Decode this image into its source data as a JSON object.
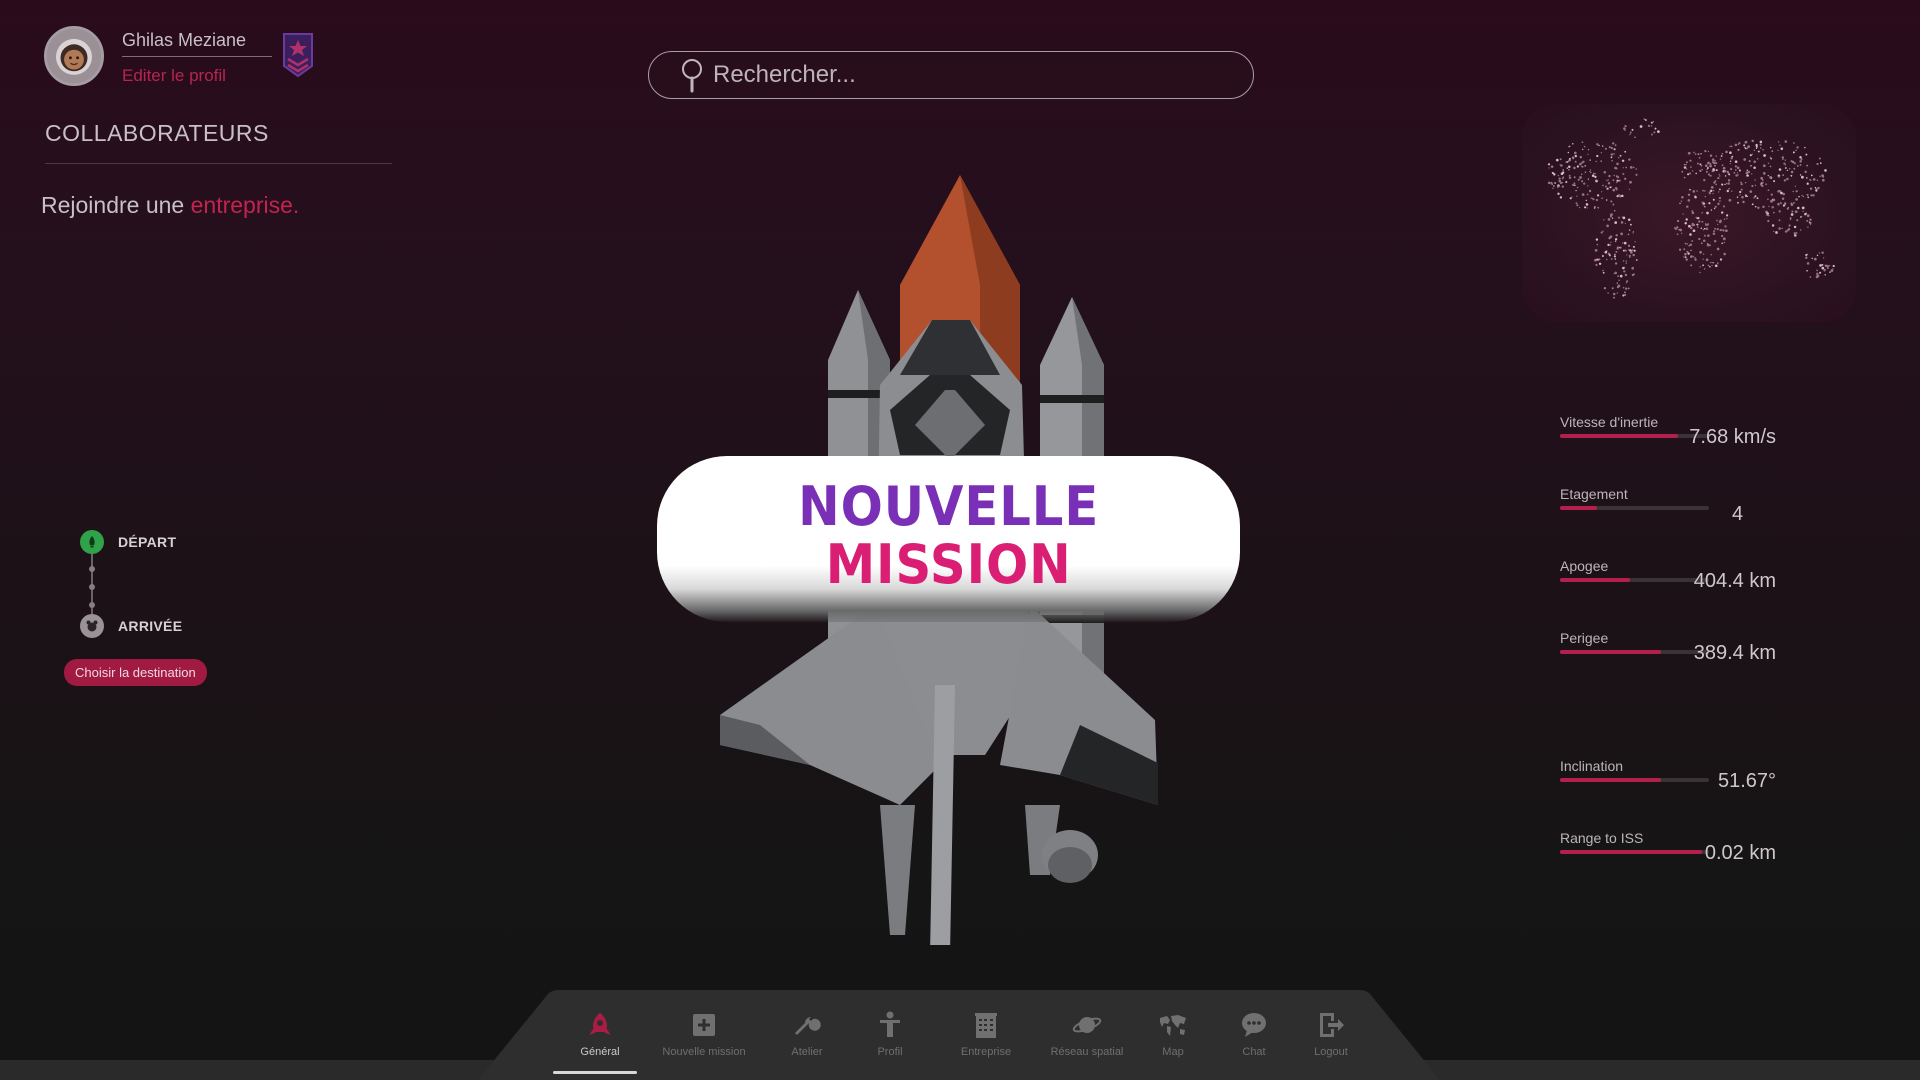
{
  "profile": {
    "name": "Ghilas Meziane",
    "edit_label": "Editer le profil",
    "avatar_icon": "astronaut-avatar",
    "badge_icon": "rank-badge-icon"
  },
  "collaborators": {
    "title": "COLLABORATEURS",
    "join_prefix": "Rejoindre une ",
    "join_link": "entreprise."
  },
  "route": {
    "start_label": "DÉPART",
    "end_label": "ARRIVÉE",
    "choose_button": "Choisir la destination"
  },
  "search": {
    "placeholder": "Rechercher..."
  },
  "mission": {
    "line1": "NOUVELLE",
    "line2": "MISSION"
  },
  "stats": [
    {
      "label": "Vitesse d'inertie",
      "value": "7.68 km/s",
      "fill": 0.79
    },
    {
      "label": "Etagement",
      "value": "4",
      "fill": 0.25
    },
    {
      "label": "Apogee",
      "value": "404.4 km",
      "fill": 0.47
    },
    {
      "label": "Perigee",
      "value": "389.4 km",
      "fill": 0.68
    },
    {
      "label": "Inclination",
      "value": "51.67°",
      "fill": 0.68
    },
    {
      "label": "Range to ISS",
      "value": "0.02 km",
      "fill": 0.95
    }
  ],
  "nav": {
    "active_index": 0,
    "items": [
      {
        "label": "Général",
        "icon": "rocket-icon"
      },
      {
        "label": "Nouvelle mission",
        "icon": "plus-square-icon"
      },
      {
        "label": "Atelier",
        "icon": "wrench-icon"
      },
      {
        "label": "Profil",
        "icon": "person-icon"
      },
      {
        "label": "Entreprise",
        "icon": "building-icon"
      },
      {
        "label": "Réseau spatial",
        "icon": "planet-icon"
      },
      {
        "label": "Map",
        "icon": "world-map-icon"
      },
      {
        "label": "Chat",
        "icon": "chat-icon"
      },
      {
        "label": "Logout",
        "icon": "logout-icon"
      }
    ]
  },
  "colors": {
    "accent": "#b41f4c",
    "mission_purple": "#7a2fb7",
    "mission_pink": "#d91e73",
    "start_green": "#2fa24a"
  }
}
